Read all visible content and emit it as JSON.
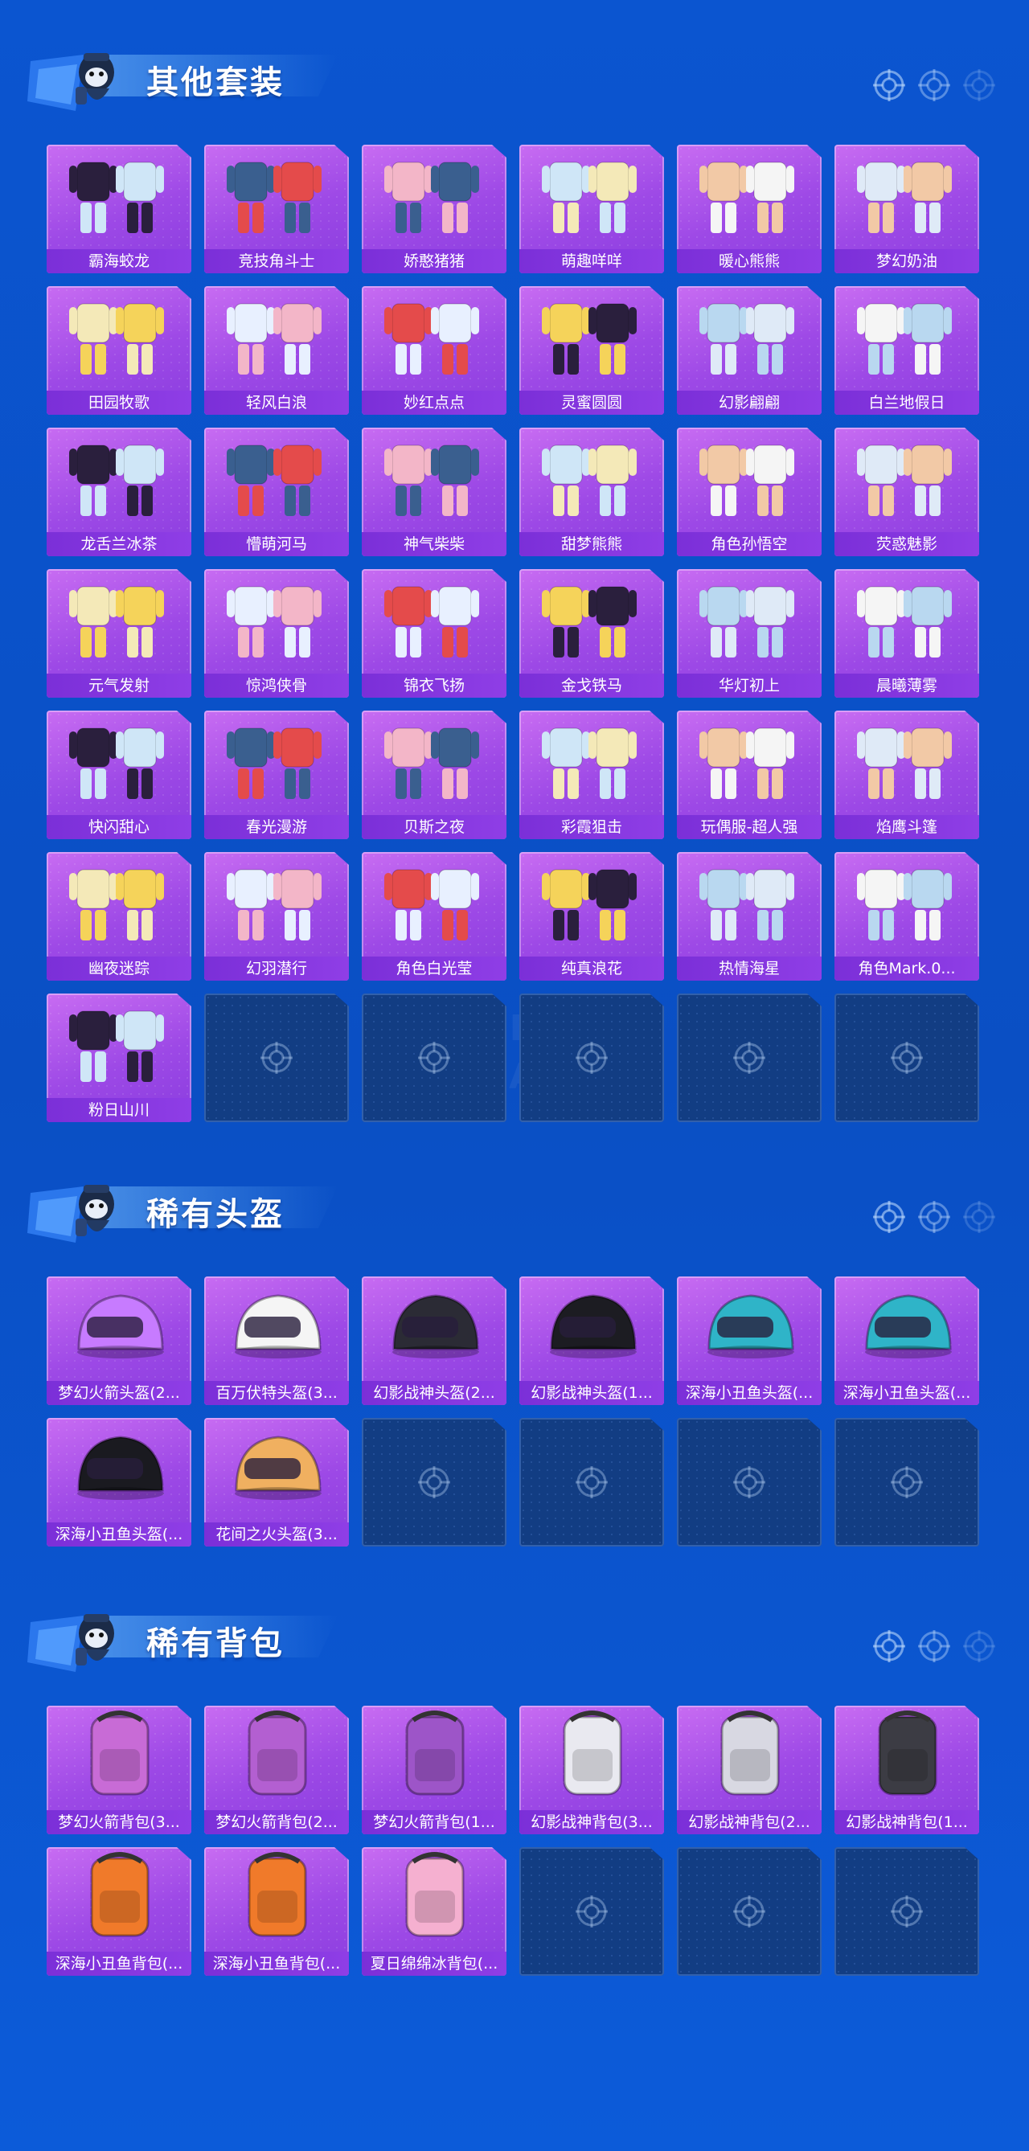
{
  "watermark": "GAME FOR PEACE",
  "sections": [
    {
      "title": "其他套装",
      "items": [
        "霸海蛟龙",
        "竞技角斗士",
        "娇憨猪猪",
        "萌趣咩咩",
        "暖心熊熊",
        "梦幻奶油",
        "田园牧歌",
        "轻风白浪",
        "妙红点点",
        "灵蜜圆圆",
        "幻影翩翩",
        "白兰地假日",
        "龙舌兰冰茶",
        "懵萌河马",
        "神气柴柴",
        "甜梦熊熊",
        "角色孙悟空",
        "荧惑魅影",
        "元气发射",
        "惊鸿侠骨",
        "锦衣飞扬",
        "金戈铁马",
        "华灯初上",
        "晨曦薄雾",
        "快闪甜心",
        "春光漫游",
        "贝斯之夜",
        "彩霞狙击",
        "玩偶服-超人强",
        "焰鹰斗篷",
        "幽夜迷踪",
        "幻羽潜行",
        "角色白光莹",
        "纯真浪花",
        "热情海星",
        "角色Mark.0...",
        "粉日山川"
      ],
      "empty_count": 5
    },
    {
      "title": "稀有头盔",
      "items": [
        "梦幻火箭头盔(2...",
        "百万伏特头盔(3...",
        "幻影战神头盔(2...",
        "幻影战神头盔(1...",
        "深海小丑鱼头盔(...",
        "深海小丑鱼头盔(...",
        "深海小丑鱼头盔(...",
        "花间之火头盔(3..."
      ],
      "empty_count": 4
    },
    {
      "title": "稀有背包",
      "items": [
        "梦幻火箭背包(3...",
        "梦幻火箭背包(2...",
        "梦幻火箭背包(1...",
        "幻影战神背包(3...",
        "幻影战神背包(2...",
        "幻影战神背包(1...",
        "深海小丑鱼背包(...",
        "深海小丑鱼背包(...",
        "夏日绵绵冰背包(..."
      ],
      "empty_count": 3
    }
  ],
  "colors": {
    "background": "#0a4fc4",
    "tile_purple": "#9d49e6",
    "label_purple": "#7b2fd8",
    "empty_tile": "#123d83"
  }
}
